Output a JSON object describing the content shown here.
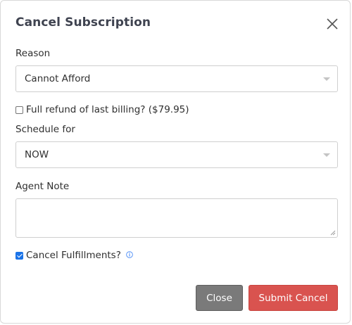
{
  "modal": {
    "title": "Cancel Subscription"
  },
  "reason": {
    "label": "Reason",
    "selected": "Cannot Afford"
  },
  "refund": {
    "label": "Full refund of last billing? ($79.95)",
    "checked": false
  },
  "schedule": {
    "label": "Schedule for",
    "selected": "NOW"
  },
  "agent_note": {
    "label": "Agent Note",
    "value": ""
  },
  "fulfillments": {
    "label": "Cancel Fulfillments?",
    "checked": true
  },
  "buttons": {
    "close_label": "Close",
    "submit_label": "Submit Cancel"
  },
  "icons": {
    "close": "close-icon",
    "info": "info-icon",
    "caret": "chevron-down-icon"
  },
  "colors": {
    "submit": "#d9534f",
    "close": "#7a7a7a",
    "checkbox_checked": "#1a73e8",
    "info_icon": "#3b82f6"
  }
}
